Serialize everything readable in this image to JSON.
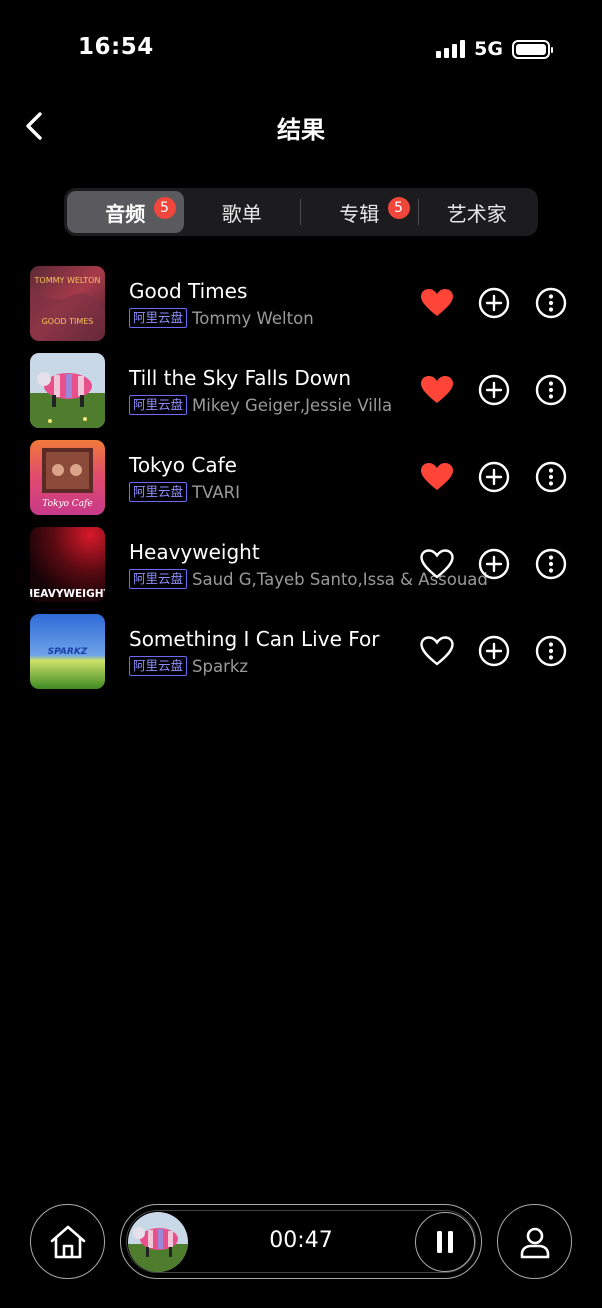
{
  "status_bar": {
    "time": "16:54",
    "network": "5G",
    "icons": [
      "signal-icon",
      "battery-icon"
    ]
  },
  "header": {
    "title": "结果",
    "back_icon": "chevron-left-icon"
  },
  "tabs": [
    {
      "label": "音频",
      "badge": "5",
      "active": true
    },
    {
      "label": "歌单",
      "badge": "",
      "active": false
    },
    {
      "label": "专辑",
      "badge": "5",
      "active": false
    },
    {
      "label": "艺术家",
      "badge": "",
      "active": false
    }
  ],
  "songs": [
    {
      "title": "Good Times",
      "source": "阿里云盘",
      "artist": "Tommy Welton",
      "liked": true,
      "cover_text_1": "TOMMY WELTON",
      "cover_text_2": "GOOD TIMES"
    },
    {
      "title": "Till the Sky Falls Down",
      "source": "阿里云盘",
      "artist": "Mikey Geiger,Jessie Villa",
      "liked": true
    },
    {
      "title": "Tokyo Cafe",
      "source": "阿里云盘",
      "artist": "TVARI",
      "liked": true,
      "cover_text_1": "Tokyo Cafe"
    },
    {
      "title": "Heavyweight",
      "source": "阿里云盘",
      "artist": "Saud G,Tayeb Santo,Issa & Assouad",
      "liked": false,
      "cover_text_1": "HEAVYWEIGHT"
    },
    {
      "title": "Something I Can Live For",
      "source": "阿里云盘",
      "artist": "Sparkz",
      "liked": false,
      "cover_text_1": "SPARKZ"
    }
  ],
  "row_icons": {
    "like": "heart-icon",
    "add": "plus-circle-icon",
    "more": "more-circle-icon"
  },
  "colors": {
    "accent_red": "#f0463c",
    "tag_blue": "#6b6bf5",
    "liked_heart": "#ff4538"
  },
  "player": {
    "elapsed": "00:47",
    "state": "playing",
    "icons": [
      "home-icon",
      "pause-icon",
      "person-icon"
    ]
  }
}
